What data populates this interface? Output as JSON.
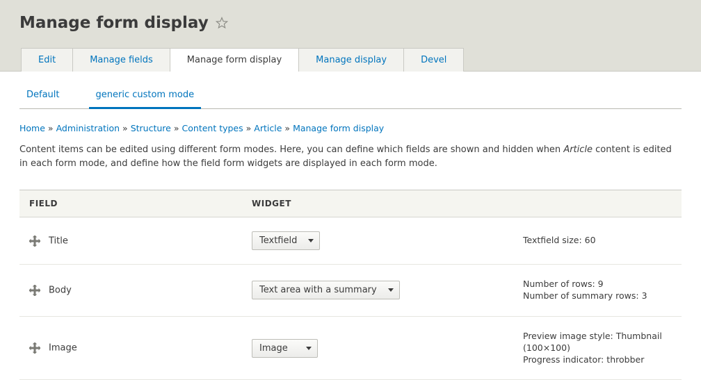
{
  "page_title": "Manage form display",
  "primary_tabs": [
    {
      "label": "Edit",
      "active": false
    },
    {
      "label": "Manage fields",
      "active": false
    },
    {
      "label": "Manage form display",
      "active": true
    },
    {
      "label": "Manage display",
      "active": false
    },
    {
      "label": "Devel",
      "active": false
    }
  ],
  "secondary_tabs": [
    {
      "label": "Default",
      "active": false
    },
    {
      "label": "generic custom mode",
      "active": true
    }
  ],
  "breadcrumb": [
    "Home",
    "Administration",
    "Structure",
    "Content types",
    "Article",
    "Manage form display"
  ],
  "help_text": {
    "before_em": "Content items can be edited using different form modes. Here, you can define which fields are shown and hidden when ",
    "em": "Article",
    "after_em": " content is edited in each form mode, and define how the field form widgets are displayed in each form mode."
  },
  "table": {
    "headers": {
      "field": "FIELD",
      "widget": "WIDGET"
    },
    "rows": [
      {
        "field": "Title",
        "widget": "Textfield",
        "summary": [
          "Textfield size: 60"
        ]
      },
      {
        "field": "Body",
        "widget": "Text area with a summary",
        "summary": [
          "Number of rows: 9",
          "Number of summary rows: 3"
        ]
      },
      {
        "field": "Image",
        "widget": "Image",
        "summary": [
          "Preview image style: Thumbnail (100×100)",
          "Progress indicator: throbber"
        ]
      }
    ]
  }
}
